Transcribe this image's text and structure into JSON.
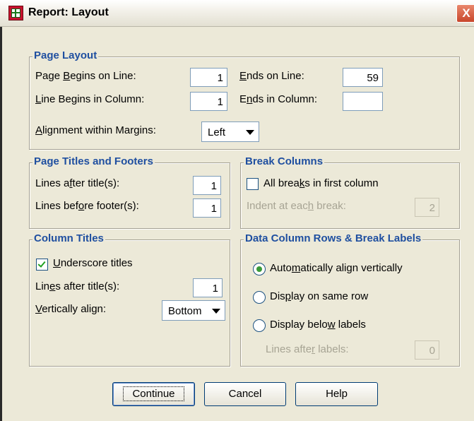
{
  "window": {
    "title": "Report: Layout",
    "close_glyph": "X"
  },
  "page_layout": {
    "title": "Page Layout",
    "page_begins_label_pre": "Page ",
    "page_begins_label_u": "B",
    "page_begins_label_post": "egins on Line:",
    "page_begins_value": "1",
    "ends_on_line_label_u": "E",
    "ends_on_line_label_post": "nds on Line:",
    "ends_on_line_value": "59",
    "line_begins_label_u": "L",
    "line_begins_label_post": "ine Begins in Column:",
    "line_begins_value": "1",
    "ends_in_column_label_pre": "E",
    "ends_in_column_label_u": "n",
    "ends_in_column_label_post": "ds in Column:",
    "ends_in_column_value": "",
    "alignment_label_u": "A",
    "alignment_label_post": "lignment within Margins:",
    "alignment_value": "Left"
  },
  "titles_footers": {
    "title": "Page Titles and Footers",
    "lines_after_label_pre": "Lines a",
    "lines_after_label_u": "f",
    "lines_after_label_post": "ter title(s):",
    "lines_after_value": "1",
    "lines_before_label_pre": "Lines bef",
    "lines_before_label_u": "o",
    "lines_before_label_post": "re footer(s):",
    "lines_before_value": "1"
  },
  "break_columns": {
    "title": "Break Columns",
    "all_breaks_label_pre": "All brea",
    "all_breaks_label_u": "k",
    "all_breaks_label_post": "s in first column",
    "all_breaks_checked": false,
    "indent_label_pre": "Indent at eac",
    "indent_label_u": "h",
    "indent_label_post": " break:",
    "indent_value": "2"
  },
  "column_titles": {
    "title": "Column Titles",
    "underscore_label_u": "U",
    "underscore_label_post": "nderscore titles",
    "underscore_checked": true,
    "lines_after_label_pre": "Lin",
    "lines_after_label_u": "e",
    "lines_after_label_post": "s after title(s):",
    "lines_after_value": "1",
    "vertical_label_u": "V",
    "vertical_label_post": "ertically align:",
    "vertical_value": "Bottom"
  },
  "data_column_rows": {
    "title": "Data Column Rows & Break Labels",
    "opt1_pre": "Auto",
    "opt1_u": "m",
    "opt1_post": "atically align vertically",
    "opt2_pre": "Dis",
    "opt2_u": "p",
    "opt2_post": "lay on same row",
    "opt3_pre": "Display belo",
    "opt3_u": "w",
    "opt3_post": " labels",
    "selected": "auto",
    "lines_after_labels_pre": "Lines afte",
    "lines_after_labels_u": "r",
    "lines_after_labels_post": " labels:",
    "lines_after_labels_value": "0"
  },
  "buttons": {
    "continue": "Continue",
    "cancel": "Cancel",
    "help": "Help"
  },
  "colors": {
    "group_title": "#1f4fa0",
    "face": "#ece9d8",
    "close": "#c8462b"
  }
}
